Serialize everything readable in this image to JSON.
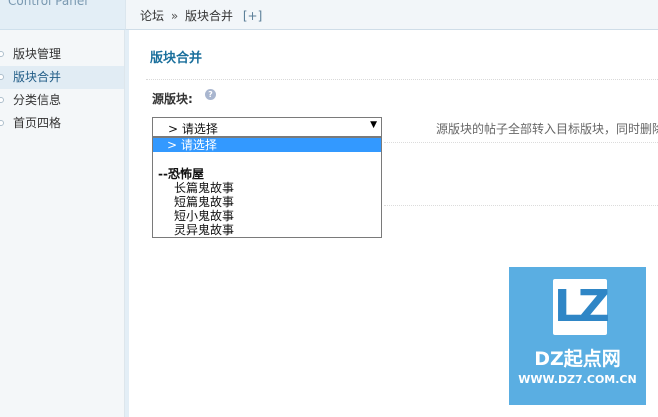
{
  "header": {
    "brand_text": "Control Panel"
  },
  "breadcrumb": {
    "items": [
      "论坛",
      "版块合并"
    ],
    "separator": "»",
    "add_label": "[+]"
  },
  "sidebar": {
    "items": [
      {
        "label": "版块管理",
        "active": false
      },
      {
        "label": "版块合并",
        "active": true
      },
      {
        "label": "分类信息",
        "active": false
      },
      {
        "label": "首页四格",
        "active": false
      }
    ]
  },
  "main": {
    "section_title": "版块合并",
    "field_label": "源版块:",
    "help_icon": "?",
    "select": {
      "value": "> 请选择",
      "arrow": "▼",
      "options": [
        {
          "label": "> 请选择",
          "selected": true,
          "group": false
        },
        {
          "label": "",
          "selected": false,
          "group": false
        },
        {
          "label": "--恐怖屋",
          "selected": false,
          "group": true
        },
        {
          "label": "长篇鬼故事",
          "selected": false,
          "group": false
        },
        {
          "label": "短篇鬼故事",
          "selected": false,
          "group": false
        },
        {
          "label": "短小鬼故事",
          "selected": false,
          "group": false
        },
        {
          "label": "灵异鬼故事",
          "selected": false,
          "group": false
        }
      ]
    },
    "description": "源版块的帖子全部转入目标版块，同时删除"
  },
  "watermark": {
    "logo": "LZ",
    "brand": "DZ起点网",
    "url": "WWW.DZ7.COM.CN"
  },
  "colors": {
    "accent": "#1a6f9c",
    "selected_option": "#3399ff",
    "watermark_bg": "#5aaee2"
  }
}
